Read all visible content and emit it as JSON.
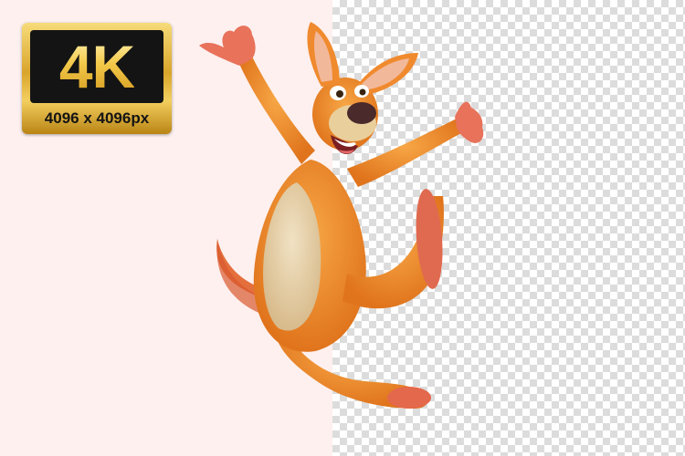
{
  "badge": {
    "big_text": "4K",
    "resolution_text": "4096 x 4096px"
  },
  "illustration": {
    "subject": "kangaroo",
    "fur_color": "#f0892a",
    "belly_color": "#e8d4b0",
    "paw_color": "#e06a4f"
  },
  "colors": {
    "left_background": "#fdf0ef",
    "checker_light": "#ffffff",
    "checker_dark": "#dcdcdc",
    "badge_gold": "#e2b43a",
    "badge_dark": "#141414"
  }
}
